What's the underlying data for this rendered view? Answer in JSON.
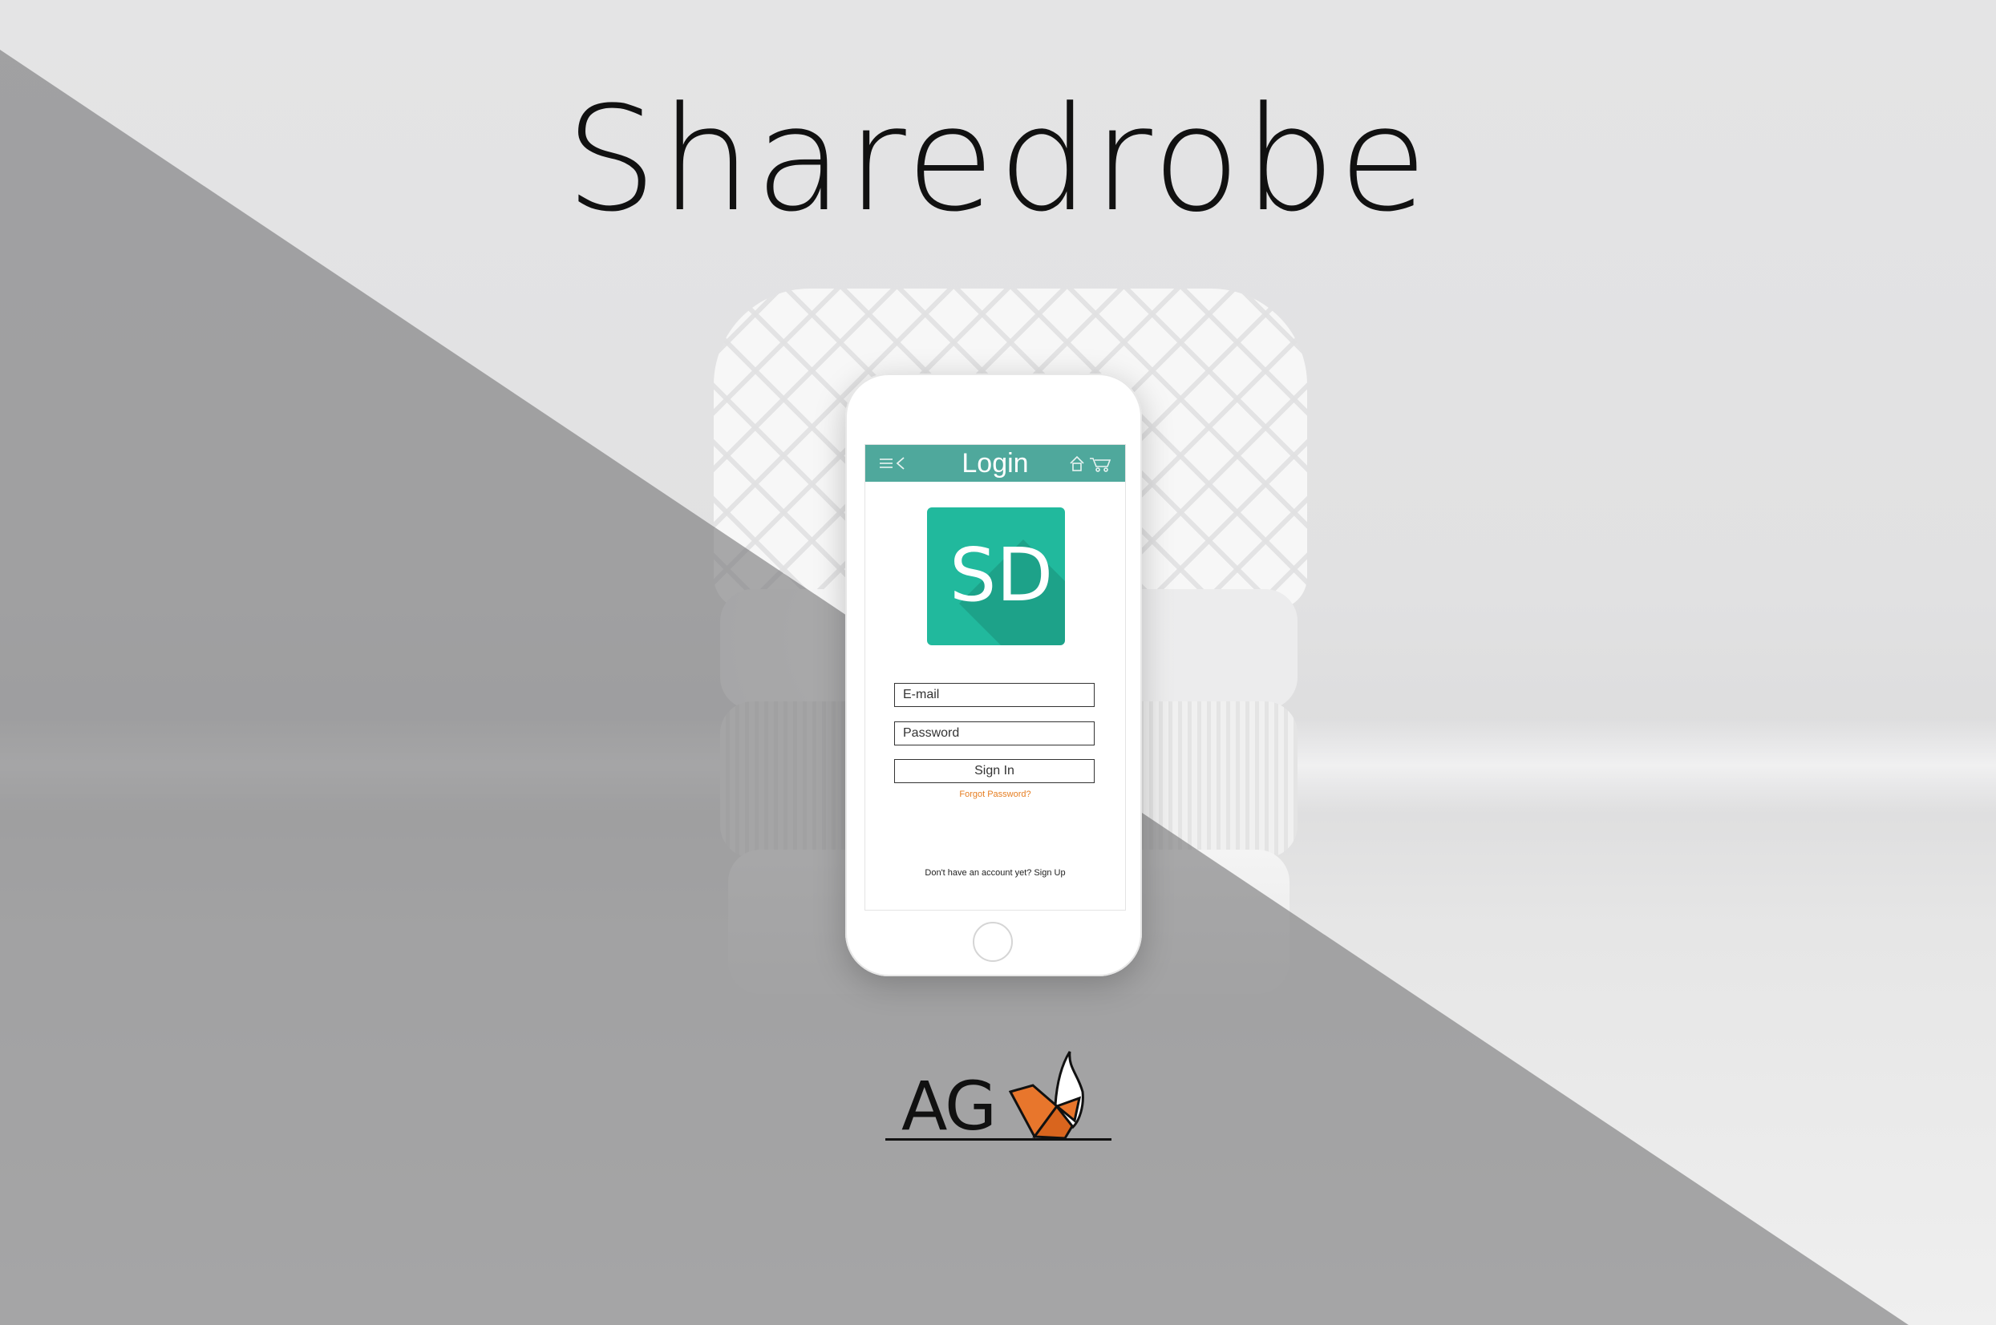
{
  "brand": {
    "title": "Sharedrobe"
  },
  "app": {
    "screen_title": "Login",
    "logo_text": "SD",
    "email_placeholder": "E-mail",
    "password_placeholder": "Password",
    "sign_in_label": "Sign In",
    "forgot_label": "Forgot Password?",
    "signup_label": "Don't have an account yet? Sign Up",
    "icons": [
      "menu-icon",
      "back-icon",
      "home-icon",
      "cart-icon"
    ]
  },
  "footer_logo": {
    "text": "AG"
  },
  "colors": {
    "appbar": "#4fa89c",
    "logo_tile": "#21b99d",
    "accent_orange": "#e67e22",
    "overlay_gray": "#8c8c8c"
  }
}
